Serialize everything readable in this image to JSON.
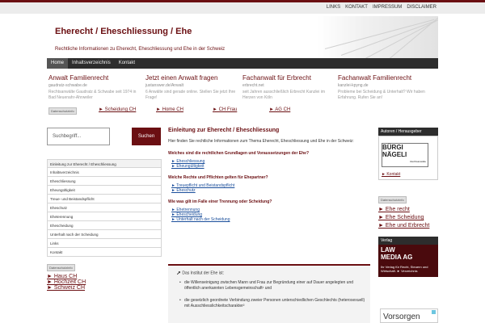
{
  "toplinks": [
    "LINKS",
    "KONTAKT",
    "IMPRESSUM",
    "DISCLAIMER"
  ],
  "header": {
    "title": "Eherecht / Eheschliessung / Ehe",
    "subtitle": "Rechtliche Informationen zu Eherecht, Eheschliessung und Ehe in der Schweiz"
  },
  "nav": [
    "Home",
    "Inhaltsverzeichnis",
    "Kontakt"
  ],
  "ads": [
    {
      "title": "Anwalt Familienrecht",
      "url": "gaudratz-schwabe.de",
      "desc": "Rechtsanwälte Gaudratz & Schwabe seit 1974 in Bad Neuenahr-Ahrweiler"
    },
    {
      "title": "Jetzt einen Anwalt fragen",
      "url": "justanswer.de/Anwalt",
      "desc": "6 Anwälte sind gerade online. Stellen Sie jetzt Ihre Frage!"
    },
    {
      "title": "Fachanwalt für Erbrecht",
      "url": "erbrecht.net",
      "desc": "seit Jahren ausschließlich Erbrecht Kanzlei im Herzen von Köln"
    },
    {
      "title": "Fachanwalt Familienrecht",
      "url": "kanzlei-kpyng.de",
      "desc": "Probleme bei Scheidung & Unterhalt? Wir haben Erfahrung. Rufen Sie an!"
    }
  ],
  "adbar": {
    "badge": "Datenschutzinfo",
    "links": [
      "► Scheidung CH",
      "► Home CH",
      "► CH Frau",
      "► AG CH"
    ]
  },
  "search": {
    "placeholder": "Suchbegriff...",
    "button": "Suchen"
  },
  "sidemenu": [
    "Einleitung zur Eherecht / Eheschliessung",
    "Inhaltsverzeichnis",
    "Eheschliessung",
    "Eheungültigkeit",
    "Treue- und Beistandspflicht",
    "Eheschutz",
    "Eheterennung",
    "Ehescheidung",
    "Unterhalt nach der Scheidung",
    "Links",
    "Kontakt"
  ],
  "sidead": {
    "badge": "Datenschutzinfo",
    "links": [
      "► Haus CH",
      "► Hochzeit CH",
      "► Schweiz CH"
    ]
  },
  "content": {
    "title": "Einleitung zur Eherecht / Eheschliessung",
    "intro": "Hier finden Sie rechtliche Informationen zum Thema Eherecht, Eheschliessung und Ehe in der Schweiz:",
    "sections": [
      {
        "q": "Welches sind die rechtlichen Grundlagen und Voraussetzungen der Ehe?",
        "links": [
          "► Eheschliessung",
          "► Eheungültigkeit"
        ]
      },
      {
        "q": "Welche Rechte und Pflichten gelten für Ehepartner?",
        "links": [
          "► Treuepflicht und Beistandspflicht",
          "► Eheschutz"
        ]
      },
      {
        "q": "Wie was gilt im Falle einer Trennung oder Scheidung?",
        "links": [
          "► Ehetrennung",
          "► Ehescheidung",
          "► Unterhalt nach der Scheidung"
        ]
      }
    ]
  },
  "quote": {
    "line1": "Das Institut der Ehe ist:",
    "items": [
      "die Willenseinigung zwischen Mann und Frau zur Begründung einer auf Dauer angelegten und öffentlich anerkannten Lebensgemeinschaft¹ und",
      "die gesetzlich geordnete Verbindung zweier Personen unterschiedlichen Geschlechts (heterosexuell) mit Ausschliesslichkeitscharakter²"
    ]
  },
  "authors": {
    "heading": "Autoren / Herausgeber",
    "logo_line1": "BÜRGI",
    "logo_line2": "NÄGELI",
    "logo_small": "Rechtsanwälte",
    "link": "► Kontakt"
  },
  "rightad": {
    "badge": "Datenschutzinfo",
    "links": [
      "► Ehe recht",
      "► Ehe Scheidung",
      "► Ehe und Erbrecht"
    ]
  },
  "verlag": {
    "heading": "Verlag",
    "logo_line1": "LAW",
    "logo_line2": "MEDIA AG",
    "desc": "Ihr Verlag für Recht, Steuern und Wirtschaft. ► Verzeichnis"
  },
  "bottomad": {
    "text": "Vorsorgen"
  },
  "colors": {
    "brand": "#6b0f12",
    "nav": "#2d2d2d",
    "link": "#1a4e9b"
  }
}
